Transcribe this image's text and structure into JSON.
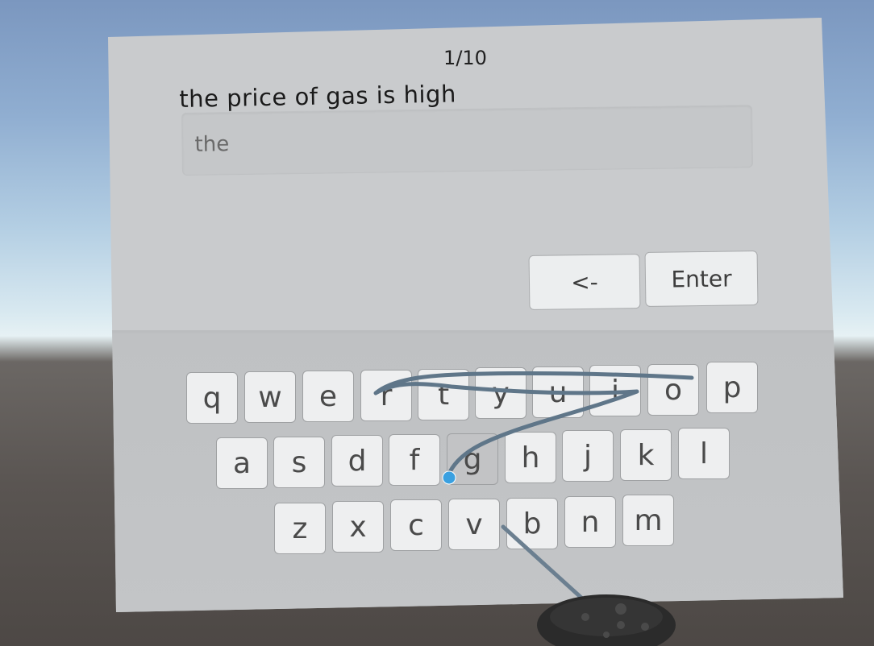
{
  "task": {
    "counter": "1/10",
    "prompt": "the price of gas is high"
  },
  "input": {
    "value": "the"
  },
  "controls": {
    "backspace_label": "<-",
    "enter_label": "Enter"
  },
  "keyboard": {
    "row1": [
      "q",
      "w",
      "e",
      "r",
      "t",
      "y",
      "u",
      "i",
      "o",
      "p"
    ],
    "row2": [
      "a",
      "s",
      "d",
      "f",
      "g",
      "h",
      "j",
      "k",
      "l"
    ],
    "row3": [
      "z",
      "x",
      "c",
      "v",
      "b",
      "n",
      "m"
    ],
    "highlighted_key": "g"
  },
  "colors": {
    "swipe_trail": "#5f7689",
    "pointer_dot": "#3aa0e0",
    "controller": "#2b2b2b"
  },
  "icons": {
    "controller": "vr-controller-icon",
    "pointer": "pointer-dot-icon"
  }
}
